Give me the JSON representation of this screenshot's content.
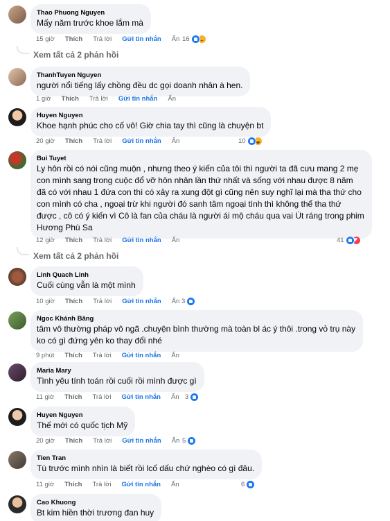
{
  "actions": {
    "like": "Thích",
    "reply": "Trả lời",
    "report": "Gửi tin nhắn",
    "hide": "Ẩn"
  },
  "comments": [
    {
      "author": "Thao Phuong Nguyen",
      "text": "Mấy năm trước khoe lắm mà",
      "time": "15 giờ",
      "reactions": "16",
      "icons": [
        "like-icon",
        "sad-icon"
      ],
      "view_more": "Xem tất cả 2 phản hồi"
    },
    {
      "author": "ThanhTuyen Nguyen",
      "text": "người nổi tiếng lấy chồng đều dc gọi doanh nhân à hen.",
      "time": "1 giờ",
      "reactions": "",
      "icons": []
    },
    {
      "author": "Huyen Nguyen",
      "text": "Khoe hạnh phúc cho cố vô! Giờ chia tay thì cũng là chuyện bt",
      "time": "20 giờ",
      "reactions": "10",
      "icons": [
        "like-icon",
        "haha-icon"
      ]
    },
    {
      "author": "Bui Tuyet",
      "text": "Ly hôn rồi có nói cũng muộn , nhưng theo ý kiến của tôi thì người ta đã cưu mang 2 mẹ\ncon mình sang trong cuộc đổ vỡ hôn nhân lần thứ nhất và sống với nhau được 8 năm\nđã có với nhau 1 đứa con thì có xảy ra xung đột gì cũng nên suy nghĩ lại mà tha thứ cho\ncon mình có cha , ngoại trừ khi người đó sanh tâm ngoại tình thì không thể tha thứ\nđược , cô có ý kiến vì Cô là fan của cháu là người ái mộ cháu qua vai Út ráng trong phim\nHương Phù Sa",
      "time": "12 giờ",
      "reactions": "41",
      "icons": [
        "like-icon",
        "love-icon"
      ],
      "view_more": "Xem tất cả 2 phản hồi"
    },
    {
      "author": "Linh Quach Linh",
      "text": "Cuối cùng vẫn là một mình",
      "time": "10 giờ",
      "reactions": "3",
      "icons": [
        "like-icon"
      ]
    },
    {
      "author": "Ngoc Khánh Băng",
      "text": "tâm vô thường pháp vô ngã .chuyện bình thường mà toàn bl ác ý thôi .trong vỏ trụ này\nko có gì đứng yên ko thay đổi nhé",
      "time": "9 phút",
      "reactions": "",
      "icons": []
    },
    {
      "author": "Maria Mary",
      "text": "Tình yêu tính toán rồi cuối rồi mình được gì",
      "time": "11 giờ",
      "reactions": "3",
      "icons": [
        "like-icon"
      ]
    },
    {
      "author": "Huyen Nguyen",
      "text": "Thế mới có quốc tịch Mỹ",
      "time": "20 giờ",
      "reactions": "5",
      "icons": [
        "like-icon"
      ]
    },
    {
      "author": "Tien Tran",
      "text": "Tù trước mình nhìn là biết rồi lcố dấu chứ nghèo có gì đâu.",
      "time": "11 giờ",
      "reactions": "6",
      "icons": [
        "like-icon"
      ]
    },
    {
      "author": "Cao Khuong",
      "text": "Bt kim hiền thời trương đan huy",
      "time": "",
      "reactions": "",
      "icons": []
    }
  ]
}
